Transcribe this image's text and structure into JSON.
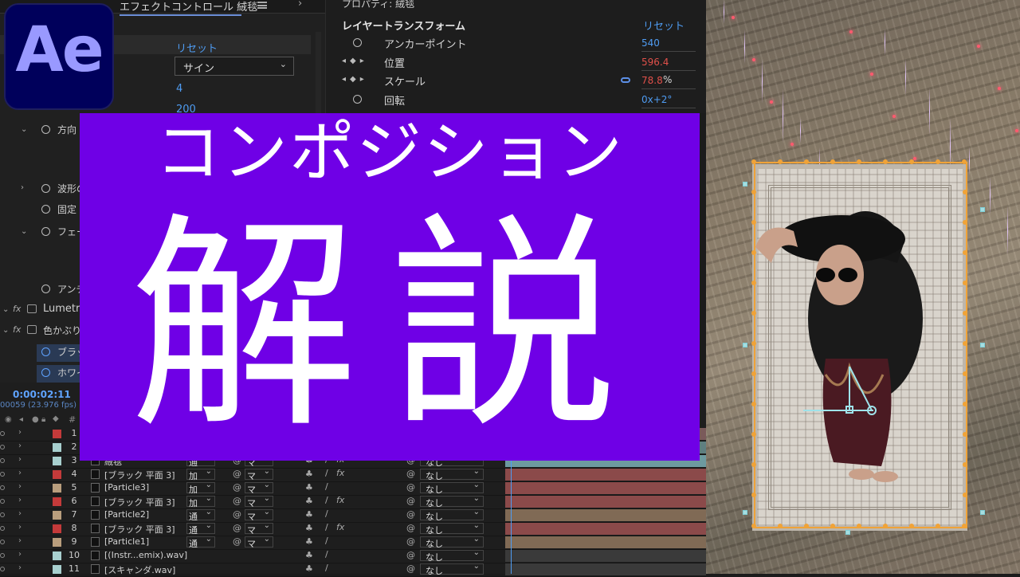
{
  "app": {
    "logo_text": "Ae"
  },
  "overlay": {
    "line1": "コンポジション",
    "line2": "解説",
    "bg_color": "#6f00e6"
  },
  "effect_controls": {
    "tab_title": "エフェクトコントロール 絨毯",
    "reset": "リセット",
    "select_value": "サイン",
    "value1": "4",
    "value2": "200",
    "rows": [
      "方向",
      "波形の",
      "固定",
      "フェー",
      "アンチ"
    ],
    "effects": [
      "Lumetri",
      "色かぶり"
    ],
    "sub_rows": [
      "ブラック",
      "ホワイ"
    ],
    "fx_glyph": "fx"
  },
  "properties": {
    "title": "プロパティ: 絨毯",
    "section": "レイヤートランスフォーム",
    "reset": "リセット",
    "items": [
      {
        "label": "アンカーポイント",
        "value": "540",
        "red": false
      },
      {
        "label": "位置",
        "value": "596.4",
        "red": true
      },
      {
        "label": "スケール",
        "value": "78.8",
        "unit": "%",
        "red": true
      },
      {
        "label": "回転",
        "value": "0x+2°",
        "red": false
      }
    ]
  },
  "timeline": {
    "timecode": "0:00:02:11",
    "fps": "00059 (23.976 fps)",
    "header_hash": "#",
    "layers": [
      {
        "num": "1",
        "name": "",
        "mode": "",
        "track": "",
        "parent": "",
        "color": "#c43a3a",
        "bar": "#7a5a5a",
        "fx": false
      },
      {
        "num": "2",
        "name": "",
        "mode": "",
        "track": "",
        "parent": "",
        "color": "#a8d0cf",
        "bar": "#5f7f80",
        "fx": false
      },
      {
        "num": "3",
        "name": "絨毯",
        "mode": "通",
        "track": "マ",
        "parent": "なし",
        "color": "#a8d0cf",
        "bar": "#6d9aa0",
        "fx": true
      },
      {
        "num": "4",
        "name": "[ブラック 平面 3]",
        "mode": "加",
        "track": "マ",
        "parent": "なし",
        "color": "#c43a3a",
        "bar": "#8b4a4a",
        "fx": true
      },
      {
        "num": "5",
        "name": "[Particle3]",
        "mode": "加",
        "track": "マ",
        "parent": "なし",
        "color": "#b99e7d",
        "bar": "#8b4a4a",
        "fx": false
      },
      {
        "num": "6",
        "name": "[ブラック 平面 3]",
        "mode": "加",
        "track": "マ",
        "parent": "なし",
        "color": "#c43a3a",
        "bar": "#8b4a4a",
        "fx": true
      },
      {
        "num": "7",
        "name": "[Particle2]",
        "mode": "通",
        "track": "マ",
        "parent": "なし",
        "color": "#b99e7d",
        "bar": "#806a55",
        "fx": false
      },
      {
        "num": "8",
        "name": "[ブラック 平面 3]",
        "mode": "通",
        "track": "マ",
        "parent": "なし",
        "color": "#c43a3a",
        "bar": "#8b4a4a",
        "fx": true
      },
      {
        "num": "9",
        "name": "[Particle1]",
        "mode": "通",
        "track": "マ",
        "parent": "なし",
        "color": "#b99e7d",
        "bar": "#806a55",
        "fx": false
      },
      {
        "num": "10",
        "name": "[(Instr...emix).wav]",
        "mode": "",
        "track": "",
        "parent": "なし",
        "color": "#a8d0cf",
        "bar": "#3a3a3a",
        "fx": false
      },
      {
        "num": "11",
        "name": "[スキャンダ.wav]",
        "mode": "",
        "track": "",
        "parent": "なし",
        "color": "#a8d0cf",
        "bar": "#3a3a3a",
        "fx": false
      }
    ]
  }
}
